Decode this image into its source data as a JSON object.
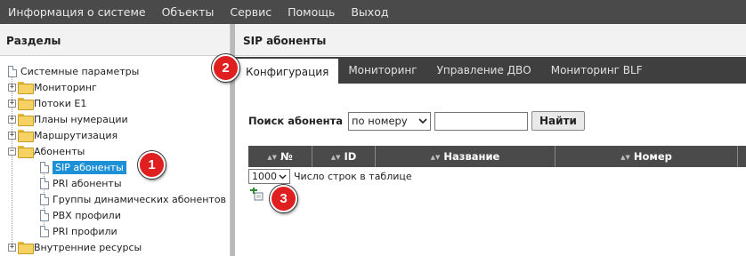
{
  "menubar": {
    "items": [
      "Информация о системе",
      "Объекты",
      "Сервис",
      "Помощь",
      "Выход"
    ]
  },
  "left_panel": {
    "header": "Разделы",
    "tree": [
      {
        "label": "Системные параметры",
        "type": "doc"
      },
      {
        "label": "Мониторинг",
        "type": "folder",
        "expander": "+"
      },
      {
        "label": "Потоки E1",
        "type": "folder",
        "expander": "+"
      },
      {
        "label": "Планы нумерации",
        "type": "folder",
        "expander": "+"
      },
      {
        "label": "Маршрутизация",
        "type": "folder",
        "expander": "+"
      },
      {
        "label": "Абоненты",
        "type": "folder",
        "expander": "−"
      },
      {
        "label": "SIP абоненты",
        "type": "doc",
        "selected": true
      },
      {
        "label": "PRI абоненты",
        "type": "doc"
      },
      {
        "label": "Группы динамических абонентов",
        "type": "doc"
      },
      {
        "label": "PBX профили",
        "type": "doc"
      },
      {
        "label": "PRI профили",
        "type": "doc"
      },
      {
        "label": "Внутренние ресурсы",
        "type": "folder",
        "expander": "+"
      }
    ]
  },
  "right_panel": {
    "header": "SIP абоненты",
    "tabs": [
      "Конфигурация",
      "Мониторинг",
      "Управление ДВО",
      "Мониторинг BLF"
    ],
    "active_tab": "Конфигурация",
    "search": {
      "label": "Поиск абонента",
      "mode": "по номеру",
      "value": "",
      "button": "Найти"
    },
    "table": {
      "columns": [
        "№",
        "ID",
        "Название",
        "Номер"
      ]
    },
    "rows_per_page": {
      "value": "1000",
      "label": "Число строк в таблице"
    }
  },
  "badges": [
    "1",
    "2",
    "3"
  ],
  "colors": {
    "menubar": "#4a4a4a",
    "selection": "#1e90d6",
    "badge": "#e02020"
  }
}
